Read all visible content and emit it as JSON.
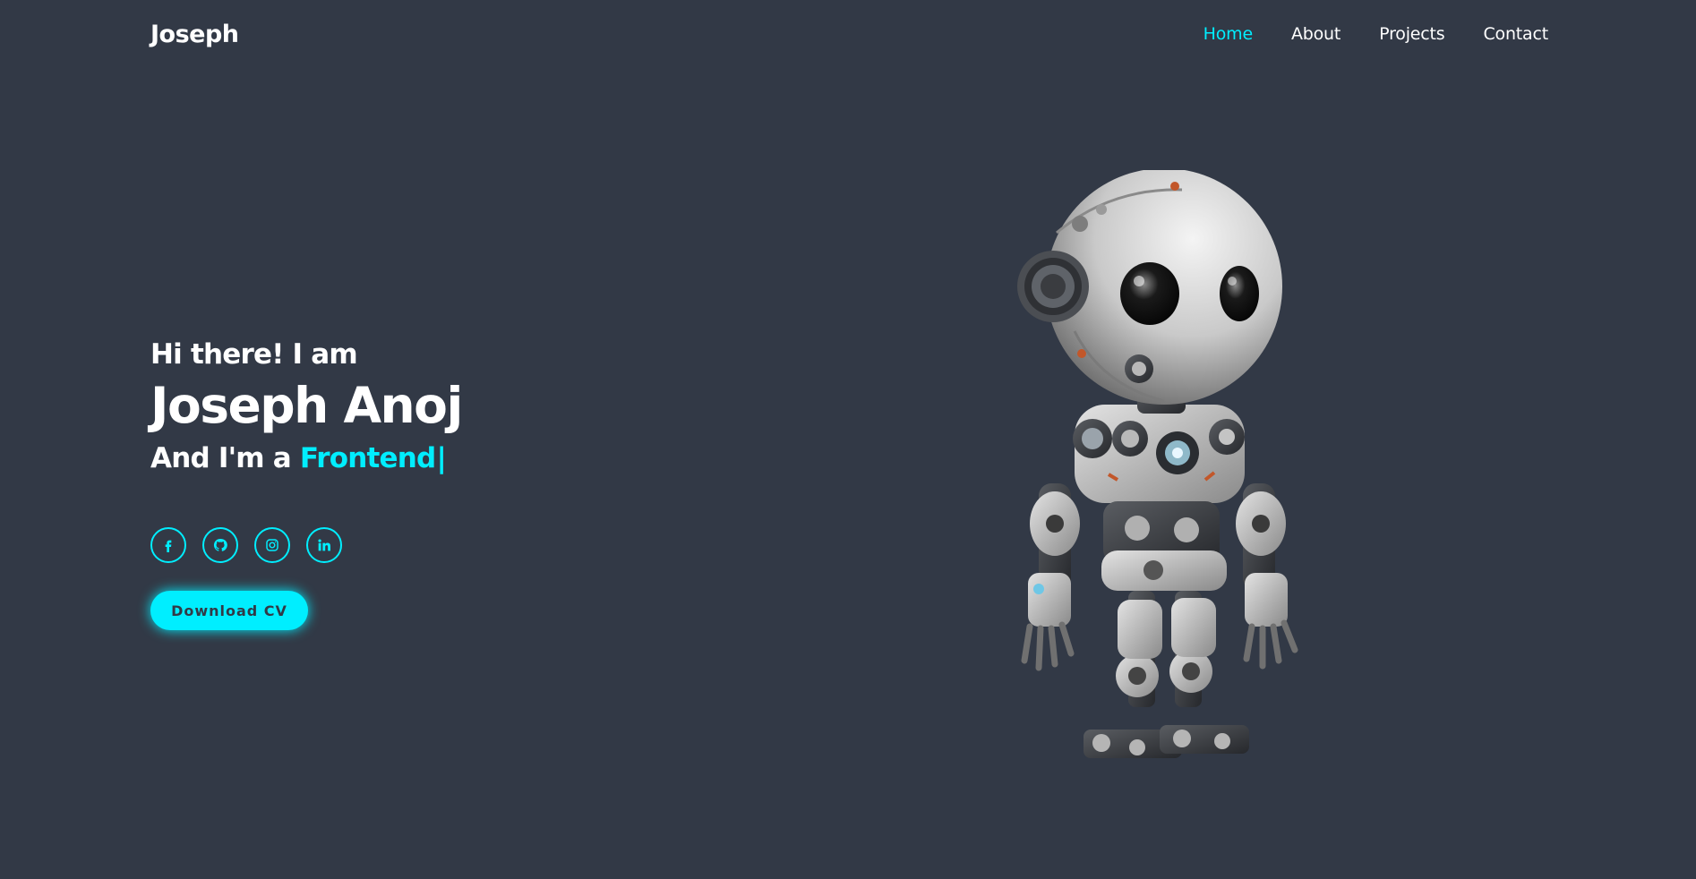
{
  "header": {
    "logo": "Joseph",
    "nav": [
      {
        "label": "Home",
        "active": true
      },
      {
        "label": "About",
        "active": false
      },
      {
        "label": "Projects",
        "active": false
      },
      {
        "label": "Contact",
        "active": false
      }
    ]
  },
  "hero": {
    "greeting": "Hi there! I am",
    "name": "Joseph Anoj",
    "role_prefix": "And I'm a",
    "role_typed": "Frontend",
    "cursor": "|"
  },
  "socials": [
    {
      "icon": "facebook-icon"
    },
    {
      "icon": "github-icon"
    },
    {
      "icon": "instagram-icon"
    },
    {
      "icon": "linkedin-icon"
    }
  ],
  "cta": {
    "label": "Download CV"
  },
  "colors": {
    "background": "#323946",
    "accent": "#00eeff",
    "text": "#ffffff"
  },
  "illustration": {
    "icon": "robot-illustration"
  }
}
